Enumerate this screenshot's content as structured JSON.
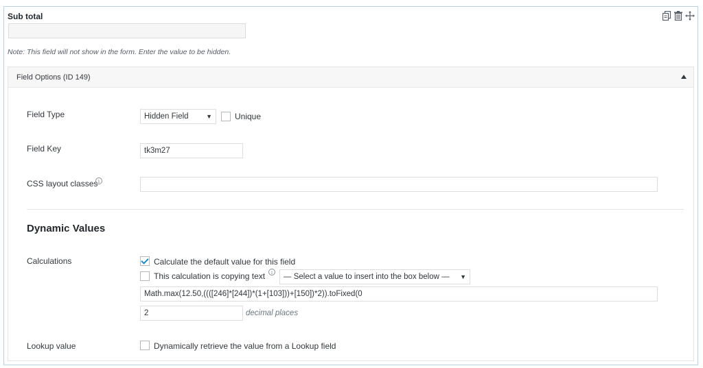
{
  "field": {
    "title": "Sub total",
    "note": "Note: This field will not show in the form. Enter the value to be hidden.",
    "preview_value": ""
  },
  "tools": {
    "duplicate_icon": "duplicate-icon",
    "delete_icon": "trash-icon",
    "move_icon": "move-icon"
  },
  "options": {
    "header": "Field Options (ID 149)",
    "field_type_label": "Field Type",
    "field_type_value": "Hidden Field",
    "unique_label": "Unique",
    "unique_checked": false,
    "field_key_label": "Field Key",
    "field_key_value": "tk3m27",
    "css_label": "CSS layout classes",
    "css_value": ""
  },
  "dynamic": {
    "heading": "Dynamic Values",
    "calculations_label": "Calculations",
    "calc_default_label": "Calculate the default value for this field",
    "calc_default_checked": true,
    "copy_text_label": "This calculation is copying text",
    "copy_text_checked": false,
    "insert_select": "— Select a value to insert into the box below —",
    "formula": "Math.max(12.50,((([246]*[244])*(1+[103]))+[150])*2)).toFixed(0",
    "decimal_value": "2",
    "decimal_hint": "decimal places",
    "lookup_label": "Lookup value",
    "lookup_option": "Dynamically retrieve the value from a Lookup field",
    "lookup_checked": false
  },
  "colors": {
    "accent": "#1e8cbe",
    "box_border": "#b7d3ea"
  }
}
